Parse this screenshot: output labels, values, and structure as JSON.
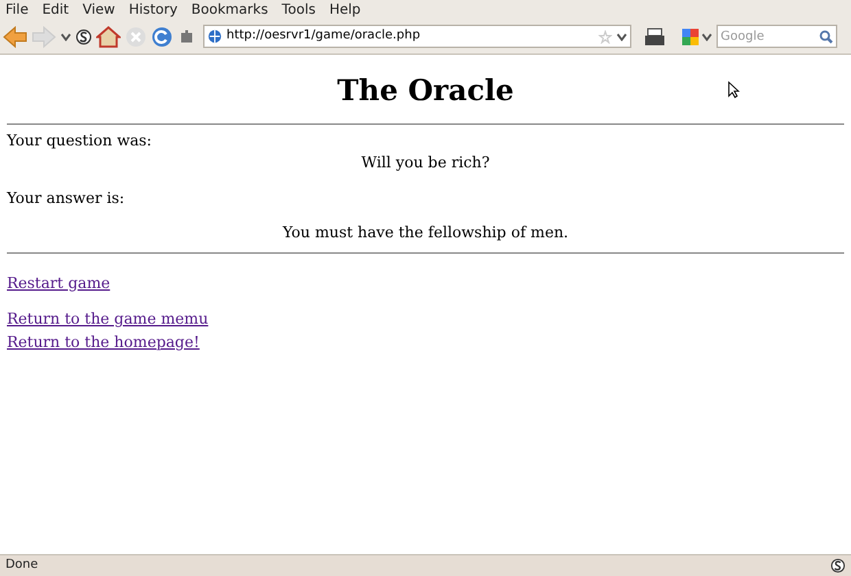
{
  "menu": [
    "File",
    "Edit",
    "View",
    "History",
    "Bookmarks",
    "Tools",
    "Help"
  ],
  "address_bar": {
    "value": "http://oesrvr1/game/oracle.php"
  },
  "search": {
    "placeholder": "Google"
  },
  "page": {
    "title": "The Oracle",
    "question_label": "Your question was:",
    "question": "Will you be rich?",
    "answer_label": "Your answer is:",
    "answer": "You must have the fellowship of men.",
    "link_groups": [
      [
        "Restart game"
      ],
      [
        "Return to the game memu",
        "Return to the homepage!"
      ]
    ]
  },
  "status_bar": {
    "text": "Done"
  }
}
